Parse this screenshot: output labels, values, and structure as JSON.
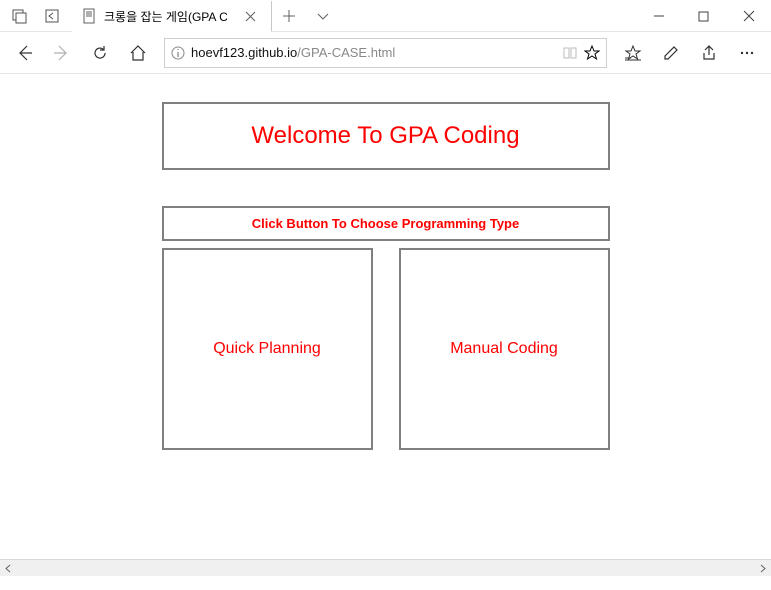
{
  "tab": {
    "label": "크롱을 잡는 게임(GPA C"
  },
  "url": {
    "domain": "hoevf123.github.io",
    "path": "/GPA-CASE.html"
  },
  "page": {
    "title": "Welcome To GPA Coding",
    "subtitle": "Click Button To Choose Programming Type",
    "option_left": "Quick Planning",
    "option_right": "Manual Coding"
  }
}
